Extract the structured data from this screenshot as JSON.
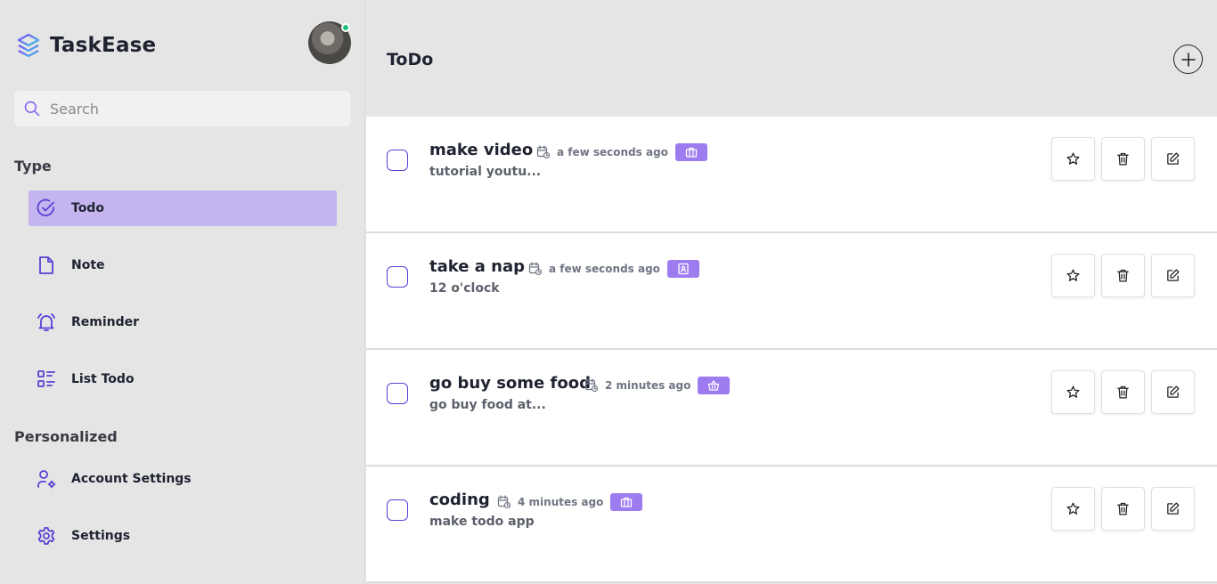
{
  "app": {
    "name": "TaskEase"
  },
  "search": {
    "placeholder": "Search"
  },
  "sidebar": {
    "type_heading": "Type",
    "personalized_heading": "Personalized",
    "type_items": [
      {
        "label": "Todo",
        "icon": "check-circle-icon",
        "active": true
      },
      {
        "label": "Note",
        "icon": "file-icon",
        "active": false
      },
      {
        "label": "Reminder",
        "icon": "bell-ringing-icon",
        "active": false
      },
      {
        "label": "List Todo",
        "icon": "list-details-icon",
        "active": false
      }
    ],
    "personal_items": [
      {
        "label": "Account Settings",
        "icon": "user-cog-icon"
      },
      {
        "label": "Settings",
        "icon": "gear-icon"
      }
    ]
  },
  "main": {
    "title": "ToDo",
    "todos": [
      {
        "title": "make video",
        "time": "a few seconds ago",
        "category": "briefcase-icon",
        "description": "tutorial youtu..."
      },
      {
        "title": "take a nap",
        "time": "a few seconds ago",
        "category": "address-book-icon",
        "description": "12 o'clock"
      },
      {
        "title": "go buy some food",
        "time": "2 minutes ago",
        "category": "basket-icon",
        "description": "go buy food at..."
      },
      {
        "title": "coding",
        "time": "4 minutes ago",
        "category": "briefcase-icon",
        "description": "make todo app"
      }
    ]
  },
  "colors": {
    "accent": "#5b3fd6",
    "active_bg": "#c4b5f0",
    "badge": "#9d7cf0",
    "online": "#1ec07a"
  }
}
